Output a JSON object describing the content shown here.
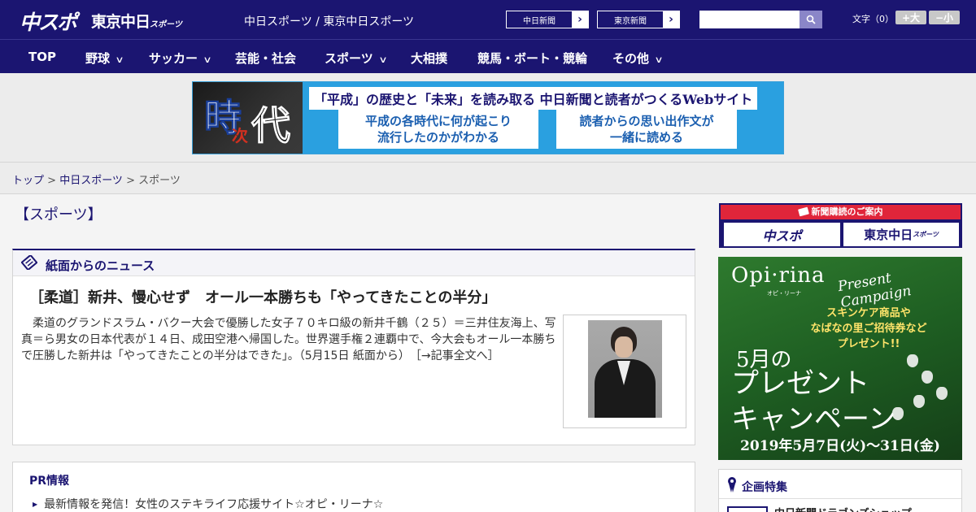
{
  "header": {
    "logo_chuspo": "中スポ",
    "logo_tokyo": "東京中日",
    "logo_tokyo_small": "スポーツ",
    "site_links": "中日スポーツ / 東京中日スポーツ",
    "paper_buttons": [
      "中日新聞",
      "東京新聞"
    ],
    "search_placeholder": "",
    "font_size_label": "文字（0）",
    "font_plus": "+大",
    "font_minus": "−小"
  },
  "nav": {
    "items": [
      {
        "label": "TOP",
        "has_menu": false
      },
      {
        "label": "野球",
        "has_menu": true
      },
      {
        "label": "サッカー",
        "has_menu": true
      },
      {
        "label": "芸能・社会",
        "has_menu": false
      },
      {
        "label": "スポーツ",
        "has_menu": true
      },
      {
        "label": "大相撲",
        "has_menu": false
      },
      {
        "label": "競馬・ボート・競輪",
        "has_menu": false
      },
      {
        "label": "その他",
        "has_menu": true
      }
    ]
  },
  "banner": {
    "kanji_1": "時",
    "kanji_2": "次",
    "kanji_3": "代",
    "headline": "「平成」の歴史と「未来」を読み取る 中日新聞と読者がつくるWebサイト",
    "box1": "平成の各時代に何が起こり\n流行したのかがわかる",
    "box2": "読者からの思い出作文が\n一緒に読める"
  },
  "breadcrumb": {
    "top": "トップ",
    "sep": " > ",
    "section": "中日スポーツ",
    "current": "スポーツ"
  },
  "page": {
    "title": "【スポーツ】"
  },
  "news": {
    "heading": "紙面からのニュース",
    "article_title": "［柔道］新井、慢心せず　オール一本勝ちも「やってきたことの半分」",
    "article_body": "柔道のグランドスラム・バクー大会で優勝した女子７０キロ級の新井千鶴（２５）＝三井住友海上、写真＝ら男女の日本代表が１４日、成田空港へ帰国した。世界選手権２連覇中で、今大会もオール一本勝ちで圧勝した新井は「やってきたことの半分はできた」。（5月15日 紙面から）",
    "more_link": "［→記事全文へ］"
  },
  "pr": {
    "title": "PR情報",
    "items": [
      "最新情報を発信！女性のステキライフ応援サイト☆オピ・リーナ☆"
    ]
  },
  "sidebar": {
    "subscribe_head": "新聞購読のご案内",
    "subscribe_buttons": [
      "中スポ",
      "東京中日"
    ],
    "subscribe_small": "スポーツ",
    "opi_logo": "Opi·rina",
    "opi_sub": "オピ・リーナ",
    "opi_campaign": "Present Campaign",
    "opi_promo": "スキンケア商品や\nなばなの里ご招待券など\nプレゼント!!",
    "opi_month": "5月の",
    "opi_big": "プレゼント\nキャンペーン",
    "opi_date": "2019年5月7日(火)〜31日(金)",
    "feature_label": "企画特集",
    "feature_item": "中日新聞ドラゴンズショップ"
  }
}
